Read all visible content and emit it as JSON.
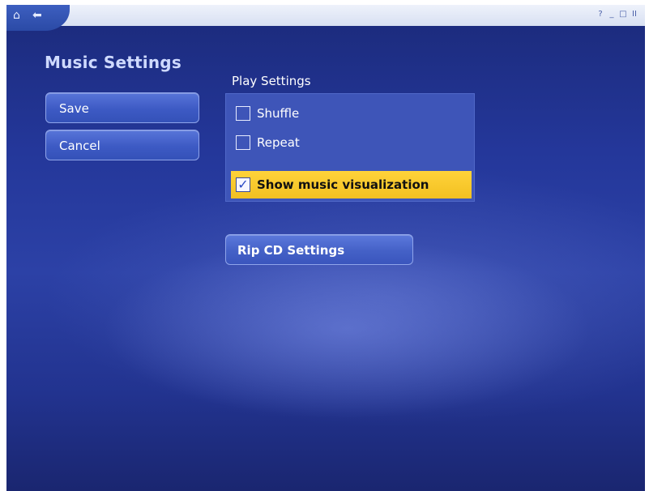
{
  "window": {
    "controls": [
      "?",
      "_",
      "□",
      "II"
    ]
  },
  "nav": {
    "home_icon": "home-icon",
    "back_icon": "back-arrow-icon"
  },
  "page": {
    "title": "Music Settings"
  },
  "left_buttons": {
    "save_label": "Save",
    "cancel_label": "Cancel"
  },
  "play_settings": {
    "heading": "Play Settings",
    "shuffle": {
      "label": "Shuffle",
      "checked": false
    },
    "repeat": {
      "label": "Repeat",
      "checked": false
    },
    "visualization": {
      "label": "Show music visualization",
      "checked": true,
      "checkmark": "✓"
    }
  },
  "rip_cd": {
    "label": "Rip CD Settings"
  },
  "colors": {
    "background": "#24379a",
    "title": "#cfdaff",
    "highlight": "#ffd33a"
  }
}
